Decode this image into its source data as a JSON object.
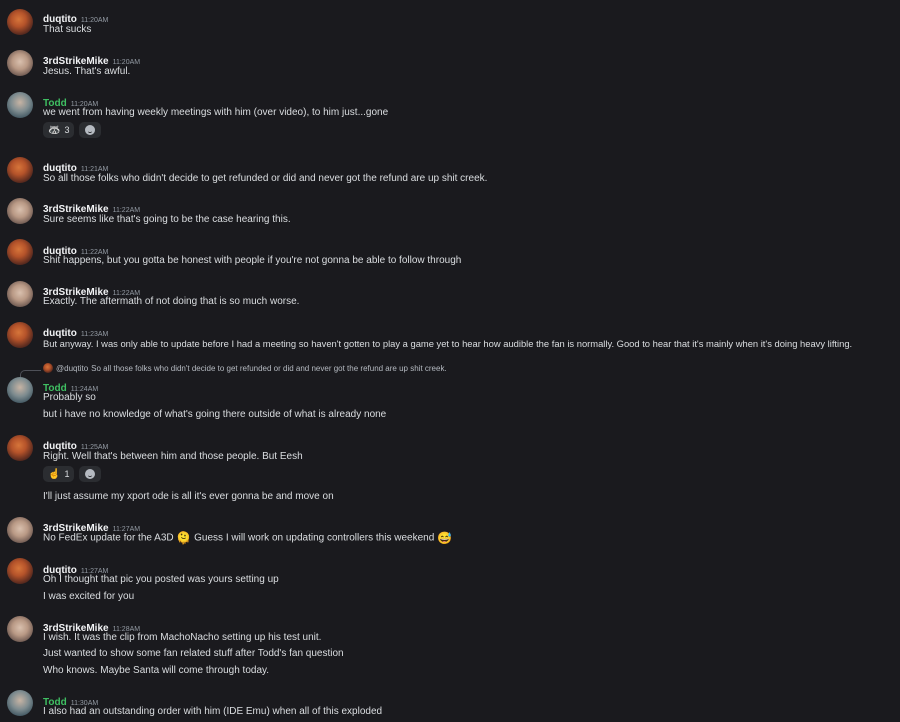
{
  "messages": [
    {
      "author": "duqtito",
      "time": "11:20AM",
      "lines": [
        "That sucks"
      ]
    },
    {
      "author": "3rdStrikeMike",
      "time": "11:20AM",
      "lines": [
        "Jesus.  That's awful."
      ]
    },
    {
      "author": "Todd",
      "time": "11:20AM",
      "lines": [
        "we went from having weekly meetings with him (over video), to him just...gone"
      ],
      "reactions": [
        {
          "emoji": "🦝",
          "count": "3"
        }
      ]
    },
    {
      "author": "duqtito",
      "time": "11:21AM",
      "lines": [
        "So all those folks who didn't decide to get refunded or did and never got the refund are up shit creek."
      ]
    },
    {
      "author": "3rdStrikeMike",
      "time": "11:22AM",
      "lines": [
        "Sure seems like that's going to be the case hearing this."
      ]
    },
    {
      "author": "duqtito",
      "time": "11:22AM",
      "lines": [
        "Shit happens, but you gotta be honest with people if you're not gonna be able to follow through"
      ]
    },
    {
      "author": "3rdStrikeMike",
      "time": "11:22AM",
      "lines": [
        "Exactly.  The aftermath of not doing that is so much worse."
      ]
    },
    {
      "author": "duqtito",
      "time": "11:23AM",
      "lines": [
        "But anyway. I was only able to update before I had a meeting so haven't gotten to play a game yet to hear how audible the fan is normally. Good to hear that it's mainly when it's doing heavy lifting."
      ]
    },
    {
      "author": "Todd",
      "time": "11:24AM",
      "reply": {
        "mention": "@duqtito",
        "text": "So all those folks who didn't decide to get refunded or did and never got the refund are up shit creek."
      },
      "lines": [
        "Probably so",
        "but i have no knowledge of what's going there outside of what is already none"
      ]
    },
    {
      "author": "duqtito",
      "time": "11:25AM",
      "lines": [
        "Right. Well that's between him and those people. But Eesh"
      ],
      "reactions": [
        {
          "emoji": "☝️",
          "count": "1"
        }
      ],
      "lines_after": [
        "I'll just assume my xport ode is all it's ever gonna be and move on"
      ]
    },
    {
      "author": "3rdStrikeMike",
      "time": "11:27AM",
      "lines": [
        "No FedEx update for the A3D",
        "  Guess I will work on updating controllers this weekend"
      ],
      "emojis": [
        "🫠",
        "😅"
      ]
    },
    {
      "author": "duqtito",
      "time": "11:27AM",
      "lines": [
        "Oh I thought that pic you posted was yours setting up",
        "I was excited for you"
      ]
    },
    {
      "author": "3rdStrikeMike",
      "time": "11:28AM",
      "lines": [
        "I wish.  It was the clip from MachoNacho setting up his test unit.",
        "Just wanted to show some fan related stuff after Todd's fan question",
        "Who knows.  Maybe Santa will come through today."
      ]
    },
    {
      "author": "Todd",
      "time": "11:30AM",
      "lines": [
        "I also had an outstanding order with him (IDE Emu) when all of this exploded"
      ]
    }
  ],
  "colors": {
    "background": "#1a1a1e",
    "todd_name": "#3fbf62",
    "default_name": "#f2f3f5",
    "text": "#dbdee1",
    "timestamp": "#949ba4"
  },
  "icons": {
    "add_reaction": "smile-plus-icon"
  }
}
